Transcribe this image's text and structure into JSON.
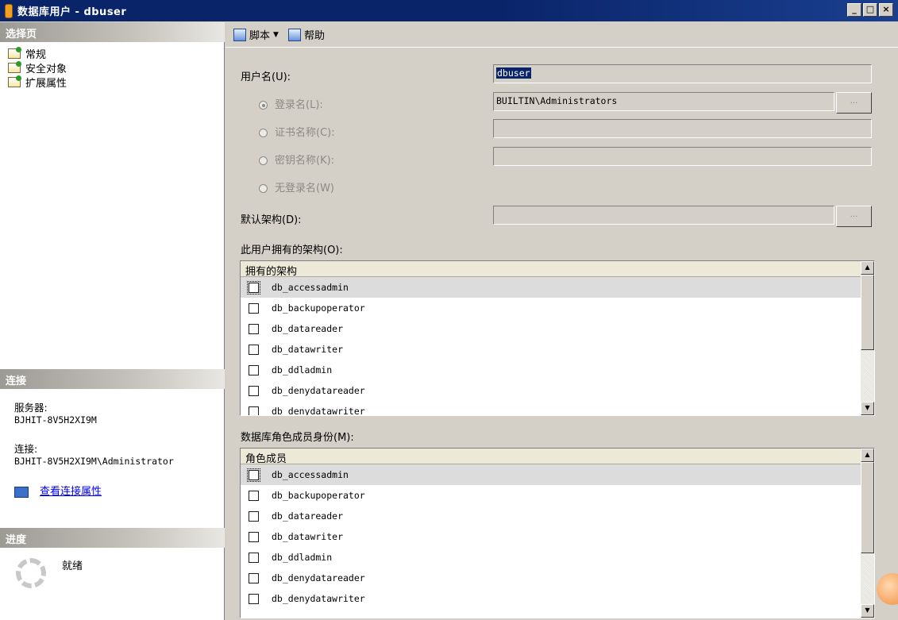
{
  "window": {
    "title": "数据库用户 - dbuser",
    "minimize": "_",
    "maximize": "□",
    "close": "×"
  },
  "left": {
    "select_page_header": "选择页",
    "pages": [
      {
        "label": "常规",
        "icon": "page-icon"
      },
      {
        "label": "安全对象",
        "icon": "page-icon"
      },
      {
        "label": "扩展属性",
        "icon": "page-icon"
      }
    ],
    "connection_header": "连接",
    "server_label": "服务器:",
    "server_value": "BJHIT-8V5H2XI9M",
    "connection_label": "连接:",
    "connection_value": "BJHIT-8V5H2XI9M\\Administrator",
    "view_conn_props": "查看连接属性",
    "progress_header": "进度",
    "progress_status": "就绪"
  },
  "toolbar": {
    "script_label": "脚本",
    "help_label": "帮助"
  },
  "form": {
    "username_label": "用户名(U):",
    "username_value": "dbuser",
    "login_name_label": "登录名(L):",
    "login_name_value": "BUILTIN\\Administrators",
    "cert_name_label": "证书名称(C):",
    "key_name_label": "密钥名称(K):",
    "no_login_label": "无登录名(W)",
    "default_schema_label": "默认架构(D):",
    "browse_label": "...",
    "owned_schemas_label": "此用户拥有的架构(O):",
    "owned_schemas_header": "拥有的架构",
    "owned_schemas": [
      "db_accessadmin",
      "db_backupoperator",
      "db_datareader",
      "db_datawriter",
      "db_ddladmin",
      "db_denydatareader",
      "db_denydatawriter"
    ],
    "role_membership_label": "数据库角色成员身份(M):",
    "role_membership_header": "角色成员",
    "roles": [
      "db_accessadmin",
      "db_backupoperator",
      "db_datareader",
      "db_datawriter",
      "db_ddladmin",
      "db_denydatareader",
      "db_denydatawriter"
    ]
  }
}
